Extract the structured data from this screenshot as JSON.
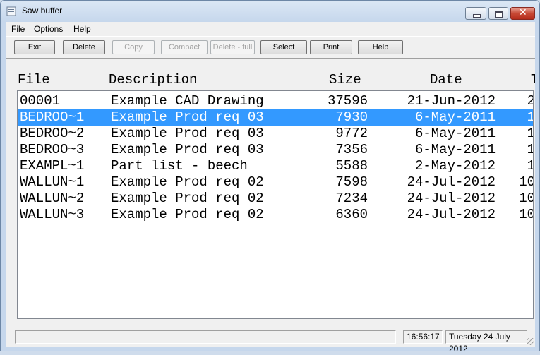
{
  "window": {
    "title": "Saw buffer"
  },
  "menu": [
    "File",
    "Options",
    "Help"
  ],
  "toolbar": {
    "buttons": [
      {
        "label": "Exit",
        "enabled": true
      },
      {
        "label": "Delete",
        "enabled": true
      },
      {
        "label": "Copy",
        "enabled": false
      },
      {
        "label": "Compact",
        "enabled": false
      },
      {
        "label": "Delete - full",
        "enabled": false
      },
      {
        "label": "Select",
        "enabled": true
      },
      {
        "label": "Print",
        "enabled": true
      },
      {
        "label": "Help",
        "enabled": true
      }
    ]
  },
  "table": {
    "columns": [
      "File",
      "Description",
      "Size",
      "Date",
      "T"
    ],
    "selected_index": 1,
    "rows": [
      {
        "file": "00001",
        "description": "Example CAD Drawing",
        "size": "37596",
        "date": "21-Jun-2012",
        "time": "2"
      },
      {
        "file": "BEDROO~1",
        "description": "Example Prod req 03",
        "size": "7930",
        "date": "6-May-2011",
        "time": "1"
      },
      {
        "file": "BEDROO~2",
        "description": "Example Prod req 03",
        "size": "9772",
        "date": "6-May-2011",
        "time": "1"
      },
      {
        "file": "BEDROO~3",
        "description": "Example Prod req 03",
        "size": "7356",
        "date": "6-May-2011",
        "time": "1"
      },
      {
        "file": "EXAMPL~1",
        "description": "Part list - beech",
        "size": "5588",
        "date": "2-May-2012",
        "time": "1"
      },
      {
        "file": "WALLUN~1",
        "description": "Example Prod req 02",
        "size": "7598",
        "date": "24-Jul-2012",
        "time": "10"
      },
      {
        "file": "WALLUN~2",
        "description": "Example Prod req 02",
        "size": "7234",
        "date": "24-Jul-2012",
        "time": "10"
      },
      {
        "file": "WALLUN~3",
        "description": "Example Prod req 02",
        "size": "6360",
        "date": "24-Jul-2012",
        "time": "10"
      }
    ]
  },
  "status": {
    "message": "",
    "time": "16:56:17",
    "date": "Tuesday  24 July 2012"
  },
  "colors": {
    "selection": "#3399ff",
    "close_button": "#c74a36"
  },
  "icons": [
    "app-icon",
    "minimize-icon",
    "maximize-icon",
    "close-icon",
    "size-grip-icon"
  ]
}
